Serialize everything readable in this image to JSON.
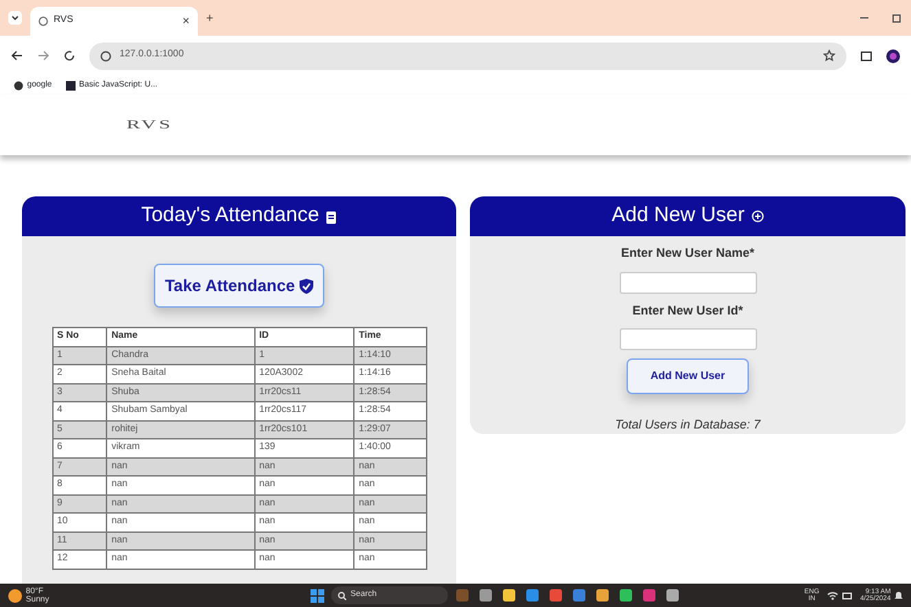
{
  "browser": {
    "tab_title": "RVS",
    "tab_close": "×",
    "new_tab": "+",
    "url": "127.0.0.1:1000",
    "bookmarks": [
      {
        "label": "google"
      },
      {
        "label": "Basic JavaScript: U..."
      }
    ]
  },
  "site": {
    "logo": "RVS"
  },
  "attendance": {
    "title": "Today's Attendance",
    "button": "Take Attendance",
    "columns": [
      "S No",
      "Name",
      "ID",
      "Time"
    ],
    "rows": [
      [
        "1",
        "Chandra",
        "1",
        "1:14:10"
      ],
      [
        "2",
        "Sneha Baital",
        "120A3002",
        "1:14:16"
      ],
      [
        "3",
        "Shuba",
        "1rr20cs11",
        "1:28:54"
      ],
      [
        "4",
        "Shubam Sambyal",
        "1rr20cs117",
        "1:28:54"
      ],
      [
        "5",
        "rohitej",
        "1rr20cs101",
        "1:29:07"
      ],
      [
        "6",
        "vikram",
        "139",
        "1:40:00"
      ],
      [
        "7",
        "nan",
        "nan",
        "nan"
      ],
      [
        "8",
        "nan",
        "nan",
        "nan"
      ],
      [
        "9",
        "nan",
        "nan",
        "nan"
      ],
      [
        "10",
        "nan",
        "nan",
        "nan"
      ],
      [
        "11",
        "nan",
        "nan",
        "nan"
      ],
      [
        "12",
        "nan",
        "nan",
        "nan"
      ]
    ]
  },
  "add_user": {
    "title": "Add New User",
    "name_label": "Enter New User Name*",
    "id_label": "Enter New User Id*",
    "button": "Add New User",
    "total": "Total Users in Database: 7"
  },
  "taskbar": {
    "weather_temp": "80°F",
    "weather_text": "Sunny",
    "search": "Search",
    "lang": "ENG",
    "region": "IN",
    "time": "9:13 AM",
    "date": "4/25/2024"
  }
}
